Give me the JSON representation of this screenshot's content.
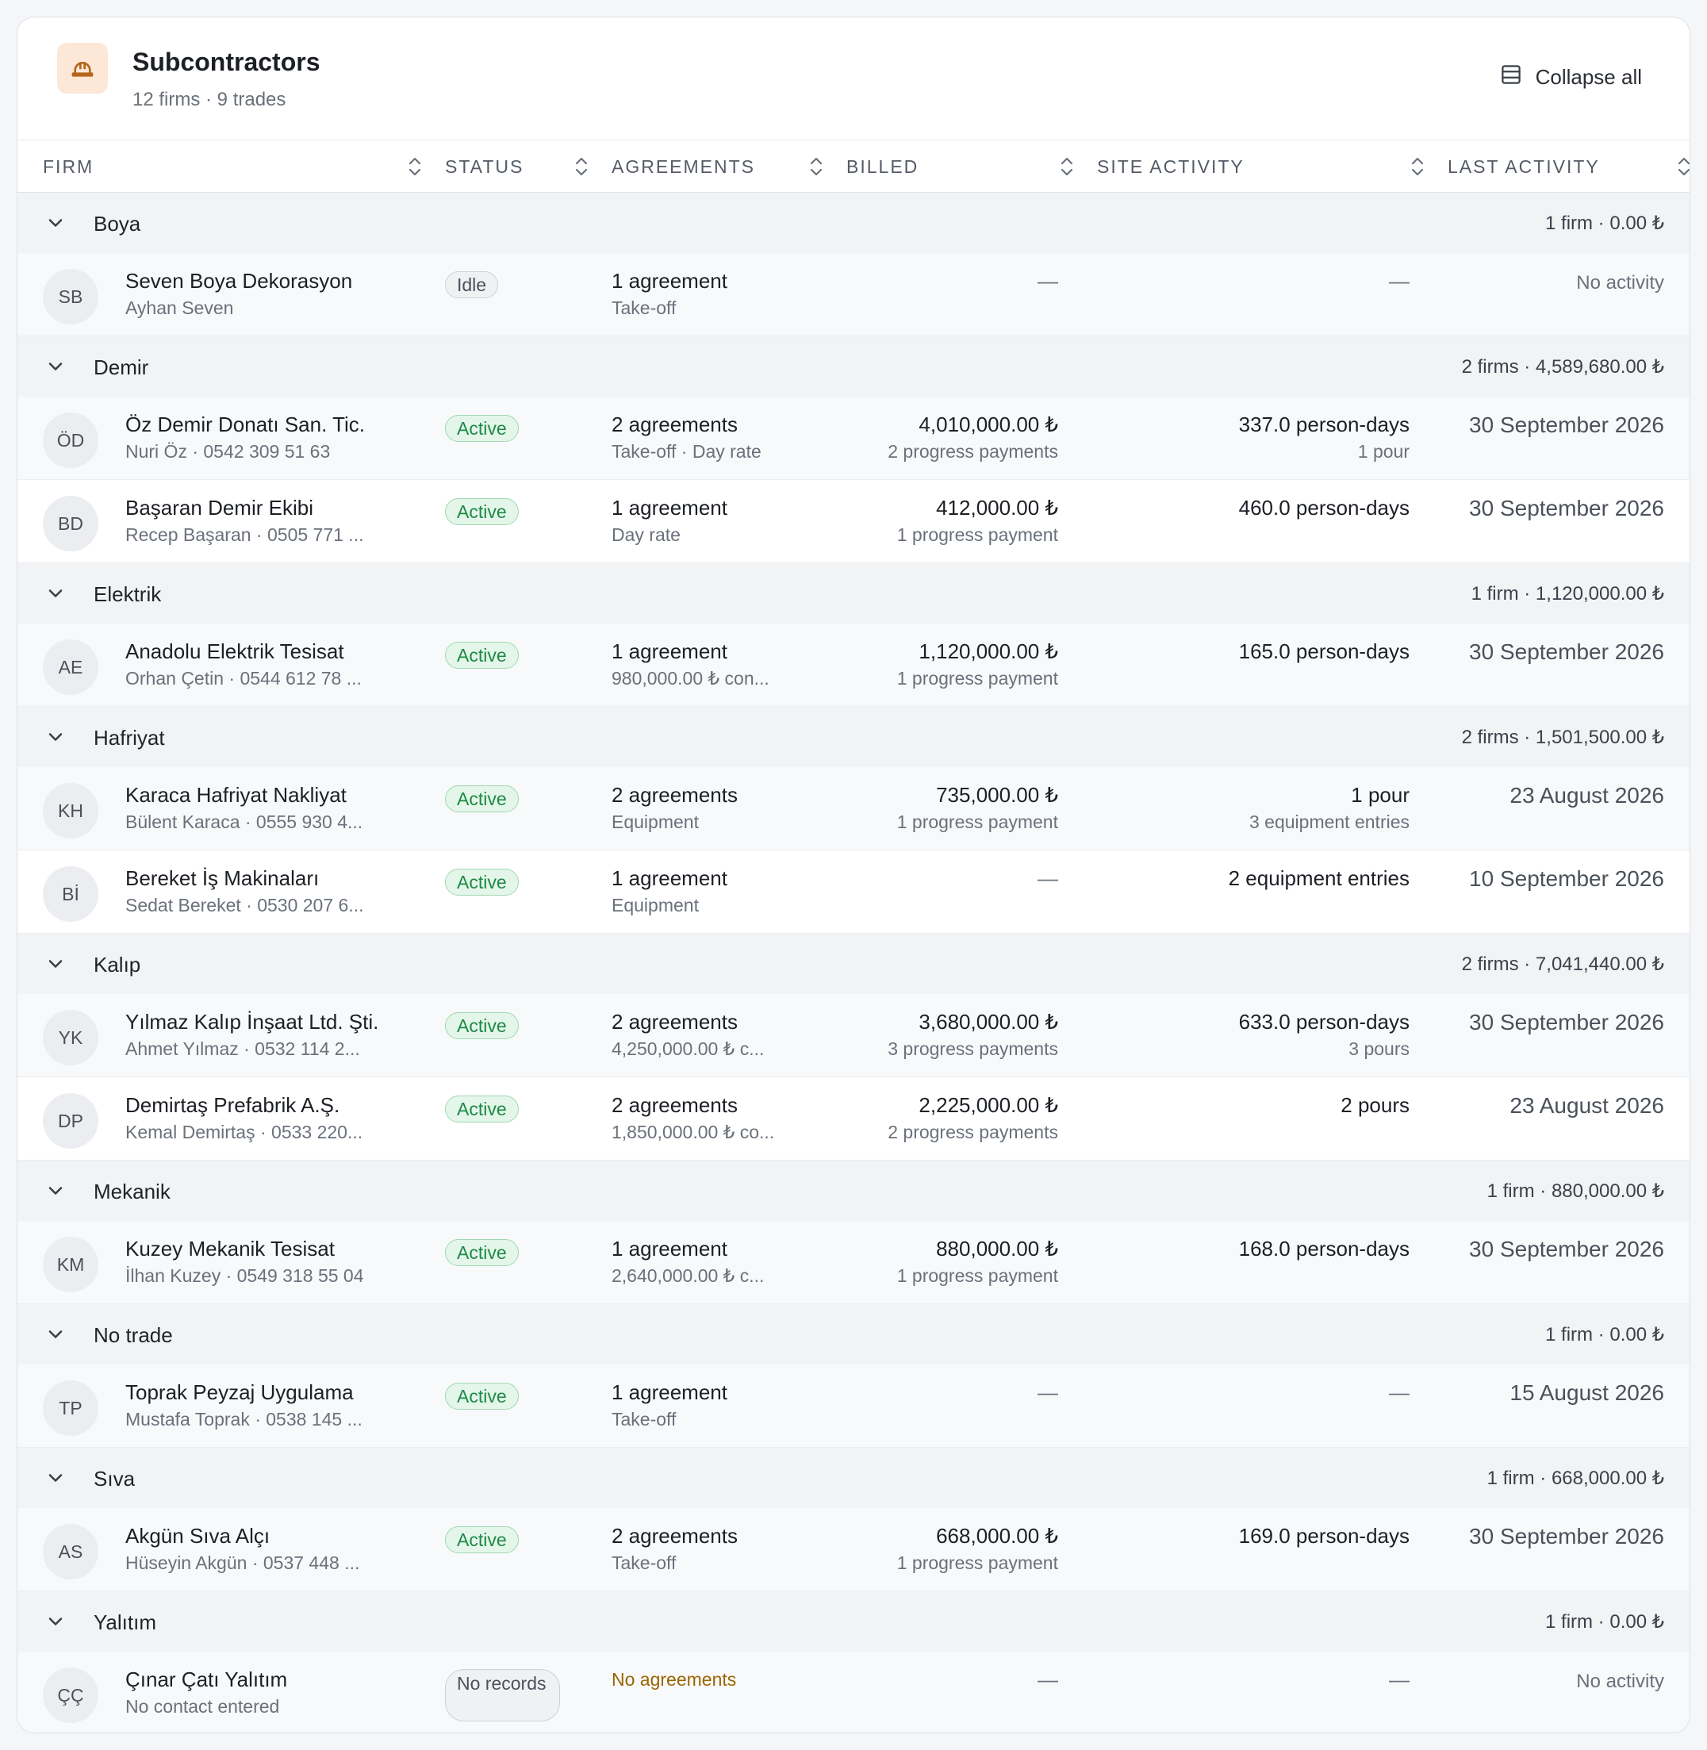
{
  "header": {
    "title": "Subcontractors",
    "subtitle": "12 firms · 9 trades",
    "icon": "hard-hat-icon",
    "collapse_label": "Collapse all"
  },
  "columns": {
    "firm": "FIRM",
    "status": "STATUS",
    "agreements": "AGREEMENTS",
    "billed": "BILLED",
    "site_activity": "SITE ACTIVITY",
    "last_activity": "LAST ACTIVITY"
  },
  "colors": {
    "active_badge_bg": "#e4f6e9",
    "active_badge_text": "#1d8a45",
    "header_icon_bg": "#fde7d6",
    "header_icon_stroke": "#b5651d",
    "warning_text": "#9a6500"
  },
  "groups": [
    {
      "name": "Boya",
      "summary": "1 firm · 0.00 ₺",
      "firms": [
        {
          "initials": "SB",
          "name": "Seven Boya Dekorasyon",
          "contact": "Ayhan Seven",
          "status": "Idle",
          "status_kind": "idle",
          "agreements": "1 agreement",
          "agreement_detail": "Take-off",
          "billed": "—",
          "billed_detail": "",
          "site": "—",
          "site_detail": "",
          "last": "No activity"
        }
      ]
    },
    {
      "name": "Demir",
      "summary": "2 firms · 4,589,680.00 ₺",
      "firms": [
        {
          "initials": "ÖD",
          "name": "Öz Demir Donatı San. Tic.",
          "contact": "Nuri Öz · 0542 309 51 63",
          "status": "Active",
          "status_kind": "active",
          "agreements": "2 agreements",
          "agreement_detail": "Take-off · Day rate",
          "billed": "4,010,000.00 ₺",
          "billed_detail": "2 progress payments",
          "site": "337.0 person-days",
          "site_detail": "1 pour",
          "last": "30 September 2026"
        },
        {
          "initials": "BD",
          "name": "Başaran Demir Ekibi",
          "contact": "Recep Başaran · 0505 771 ...",
          "status": "Active",
          "status_kind": "active",
          "agreements": "1 agreement",
          "agreement_detail": "Day rate",
          "billed": "412,000.00 ₺",
          "billed_detail": "1 progress payment",
          "site": "460.0 person-days",
          "site_detail": "",
          "last": "30 September 2026"
        }
      ]
    },
    {
      "name": "Elektrik",
      "summary": "1 firm · 1,120,000.00 ₺",
      "firms": [
        {
          "initials": "AE",
          "name": "Anadolu Elektrik Tesisat",
          "contact": "Orhan Çetin · 0544 612 78 ...",
          "status": "Active",
          "status_kind": "active",
          "agreements": "1 agreement",
          "agreement_detail": "980,000.00 ₺ con...",
          "billed": "1,120,000.00 ₺",
          "billed_detail": "1 progress payment",
          "site": "165.0 person-days",
          "site_detail": "",
          "last": "30 September 2026"
        }
      ]
    },
    {
      "name": "Hafriyat",
      "summary": "2 firms · 1,501,500.00 ₺",
      "firms": [
        {
          "initials": "KH",
          "name": "Karaca Hafriyat Nakliyat",
          "contact": "Bülent Karaca · 0555 930 4...",
          "status": "Active",
          "status_kind": "active",
          "agreements": "2 agreements",
          "agreement_detail": "Equipment",
          "billed": "735,000.00 ₺",
          "billed_detail": "1 progress payment",
          "site": "1 pour",
          "site_detail": "3 equipment entries",
          "last": "23 August 2026"
        },
        {
          "initials": "Bİ",
          "name": "Bereket İş Makinaları",
          "contact": "Sedat Bereket · 0530 207 6...",
          "status": "Active",
          "status_kind": "active",
          "agreements": "1 agreement",
          "agreement_detail": "Equipment",
          "billed": "—",
          "billed_detail": "",
          "site": "2 equipment entries",
          "site_detail": "",
          "last": "10 September 2026"
        }
      ]
    },
    {
      "name": "Kalıp",
      "summary": "2 firms · 7,041,440.00 ₺",
      "firms": [
        {
          "initials": "YK",
          "name": "Yılmaz Kalıp İnşaat Ltd. Şti.",
          "contact": "Ahmet Yılmaz · 0532 114 2...",
          "status": "Active",
          "status_kind": "active",
          "agreements": "2 agreements",
          "agreement_detail": "4,250,000.00 ₺ c...",
          "billed": "3,680,000.00 ₺",
          "billed_detail": "3 progress payments",
          "site": "633.0 person-days",
          "site_detail": "3 pours",
          "last": "30 September 2026"
        },
        {
          "initials": "DP",
          "name": "Demirtaş Prefabrik A.Ş.",
          "contact": "Kemal Demirtaş · 0533 220...",
          "status": "Active",
          "status_kind": "active",
          "agreements": "2 agreements",
          "agreement_detail": "1,850,000.00 ₺ co...",
          "billed": "2,225,000.00 ₺",
          "billed_detail": "2 progress payments",
          "site": "2 pours",
          "site_detail": "",
          "last": "23 August 2026"
        }
      ]
    },
    {
      "name": "Mekanik",
      "summary": "1 firm · 880,000.00 ₺",
      "firms": [
        {
          "initials": "KM",
          "name": "Kuzey Mekanik Tesisat",
          "contact": "İlhan Kuzey · 0549 318 55 04",
          "status": "Active",
          "status_kind": "active",
          "agreements": "1 agreement",
          "agreement_detail": "2,640,000.00 ₺ c...",
          "billed": "880,000.00 ₺",
          "billed_detail": "1 progress payment",
          "site": "168.0 person-days",
          "site_detail": "",
          "last": "30 September 2026"
        }
      ]
    },
    {
      "name": "No trade",
      "summary": "1 firm · 0.00 ₺",
      "firms": [
        {
          "initials": "TP",
          "name": "Toprak Peyzaj Uygulama",
          "contact": "Mustafa Toprak · 0538 145 ...",
          "status": "Active",
          "status_kind": "active",
          "agreements": "1 agreement",
          "agreement_detail": "Take-off",
          "billed": "—",
          "billed_detail": "",
          "site": "—",
          "site_detail": "",
          "last": "15 August 2026"
        }
      ]
    },
    {
      "name": "Sıva",
      "summary": "1 firm · 668,000.00 ₺",
      "firms": [
        {
          "initials": "AS",
          "name": "Akgün Sıva Alçı",
          "contact": "Hüseyin Akgün · 0537 448 ...",
          "status": "Active",
          "status_kind": "active",
          "agreements": "2 agreements",
          "agreement_detail": "Take-off",
          "billed": "668,000.00 ₺",
          "billed_detail": "1 progress payment",
          "site": "169.0 person-days",
          "site_detail": "",
          "last": "30 September 2026"
        }
      ]
    },
    {
      "name": "Yalıtım",
      "summary": "1 firm · 0.00 ₺",
      "firms": [
        {
          "initials": "ÇÇ",
          "name": "Çınar Çatı Yalıtım",
          "contact": "No contact entered",
          "status": "No records",
          "status_kind": "norec",
          "agreements": "No agreements",
          "agreement_detail": "",
          "billed": "—",
          "billed_detail": "",
          "site": "—",
          "site_detail": "",
          "last": "No activity"
        }
      ]
    }
  ]
}
